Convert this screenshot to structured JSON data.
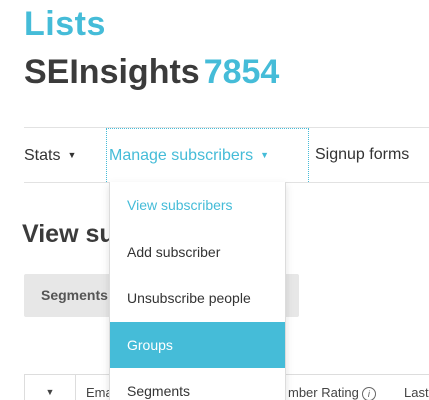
{
  "header": {
    "section_title": "Lists",
    "list_name": "SEInsights",
    "list_id": "7854"
  },
  "nav": {
    "stats_label": "Stats",
    "manage_label": "Manage subscribers",
    "signup_label": "Signup forms",
    "caret_glyph": "▼"
  },
  "page": {
    "heading": "View su",
    "segments_button": "Segments"
  },
  "dropdown": {
    "items": [
      {
        "label": "View subscribers",
        "state": "current"
      },
      {
        "label": "Add subscriber",
        "state": "normal"
      },
      {
        "label": "Unsubscribe people",
        "state": "normal"
      },
      {
        "label": "Groups",
        "state": "hovered"
      },
      {
        "label": "Segments",
        "state": "normal"
      }
    ]
  },
  "table": {
    "select_caret": "▼",
    "col_email": "Ema",
    "col_rating": "mber Rating",
    "info_glyph": "i",
    "col_last": "Last"
  },
  "colors": {
    "accent": "#45bcd8",
    "heading_dark": "#3b3b3b",
    "button_gray": "#e7e7e7"
  }
}
